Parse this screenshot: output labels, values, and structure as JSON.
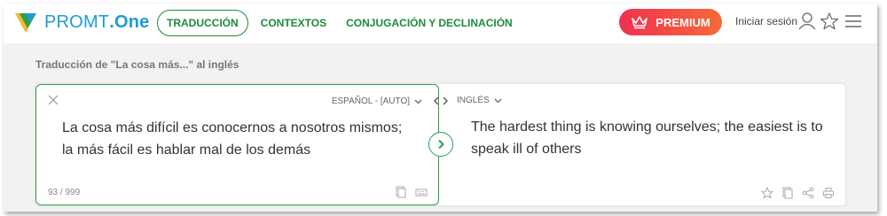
{
  "header": {
    "logo_name": "PROMT",
    "logo_suffix": ".One",
    "nav": [
      {
        "label": "TRADUCCIÓN",
        "active": true
      },
      {
        "label": "CONTEXTOS",
        "active": false
      },
      {
        "label": "CONJUGACIÓN Y DECLINACIÓN",
        "active": false
      }
    ],
    "premium_label": "PREMIUM",
    "login_label": "Iniciar sesión"
  },
  "page_title": "Traducción de \"La cosa más...\" al inglés",
  "translator": {
    "source_lang": "ESPAÑOL - [AUTO]",
    "target_lang": "INGLÉS",
    "source_text": "La cosa más difícil es conocernos a nosotros mismos; la más fácil es hablar mal de los demás",
    "target_text": "The hardest thing is knowing ourselves; the easiest is to speak ill of others",
    "char_counter": "93 / 999"
  },
  "colors": {
    "brand_green": "#1c8b3b",
    "pane_border": "#2ba04a",
    "premium_start": "#f0304f",
    "premium_end": "#f56a3a",
    "logo_blue": "#1f9bd6"
  }
}
